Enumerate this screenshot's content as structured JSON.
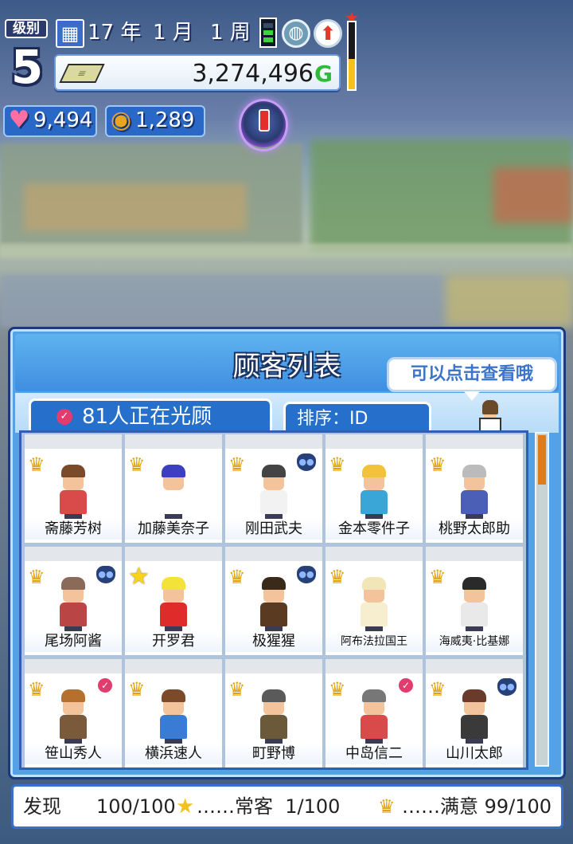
{
  "hud": {
    "level_label": "级别",
    "level": "5",
    "date": {
      "year": "17 年",
      "month": "1 月",
      "week": "1 周"
    },
    "money": "3,274,496",
    "money_unit": "G",
    "hearts": "9,494",
    "coins": "1,289",
    "gauge_level": 0.45,
    "icons": [
      "calendar-icon",
      "signal-icon",
      "globe-icon",
      "upgrade-arrow-icon",
      "boss-orb-icon"
    ]
  },
  "panel": {
    "title": "顾客列表",
    "tooltip": "可以点击查看哦",
    "tab_visiting": "81人正在光顾",
    "tab_sort": "排序：ID"
  },
  "customers": [
    {
      "name": "斋藤芳树",
      "badge": "crown",
      "tag": "",
      "hair": "#7a4a2a",
      "shirt": "#d94b4b"
    },
    {
      "name": "加藤美奈子",
      "badge": "crown",
      "tag": "",
      "hair": "#3b3fc0",
      "shirt": "#ffffff"
    },
    {
      "name": "刚田武夫",
      "badge": "crown",
      "tag": "cat",
      "hair": "#444444",
      "shirt": "#f2f2f2"
    },
    {
      "name": "金本零件子",
      "badge": "crown",
      "tag": "",
      "hair": "#f2c23a",
      "shirt": "#3aa6d8"
    },
    {
      "name": "桃野太郎助",
      "badge": "crown",
      "tag": "",
      "hair": "#bbbbbb",
      "shirt": "#4a5fb5"
    },
    {
      "name": "尾场阿酱",
      "badge": "crown",
      "tag": "cat",
      "hair": "#8a6b5a",
      "shirt": "#b94545"
    },
    {
      "name": "开罗君",
      "badge": "star",
      "tag": "",
      "hair": "#f3e23a",
      "shirt": "#e02b2b"
    },
    {
      "name": "极猩猩",
      "badge": "crown",
      "tag": "cat",
      "hair": "#3a2a1a",
      "shirt": "#5a3b22"
    },
    {
      "name": "阿布法拉国王",
      "badge": "crown",
      "tag": "",
      "hair": "#f1e6b8",
      "shirt": "#f7eecf"
    },
    {
      "name": "海威夷·比基娜",
      "badge": "crown",
      "tag": "",
      "hair": "#2a2a2a",
      "shirt": "#e9e9e9"
    },
    {
      "name": "笹山秀人",
      "badge": "crown",
      "tag": "heart",
      "hair": "#b5702e",
      "shirt": "#7a5a3a"
    },
    {
      "name": "横浜速人",
      "badge": "crown",
      "tag": "",
      "hair": "#7a4a2a",
      "shirt": "#3a7bd5"
    },
    {
      "name": "町野博",
      "badge": "crown",
      "tag": "",
      "hair": "#5a5a5a",
      "shirt": "#6b5a3a"
    },
    {
      "name": "中岛信二",
      "badge": "crown",
      "tag": "heart",
      "hair": "#777777",
      "shirt": "#d94b4b"
    },
    {
      "name": "山川太郎",
      "badge": "crown",
      "tag": "cat",
      "hair": "#6a3a2a",
      "shirt": "#3a3a3a"
    }
  ],
  "footer": {
    "label": "发现",
    "discovered": "100/100",
    "regular_label": "……常客",
    "regular": "1/100",
    "satisfied_label": "……满意",
    "satisfied": "99/100"
  },
  "colors": {
    "panel": "#54a1e6",
    "tab": "#2670cb",
    "crown": "#e2a30e",
    "money_unit": "#2fbb3a"
  }
}
